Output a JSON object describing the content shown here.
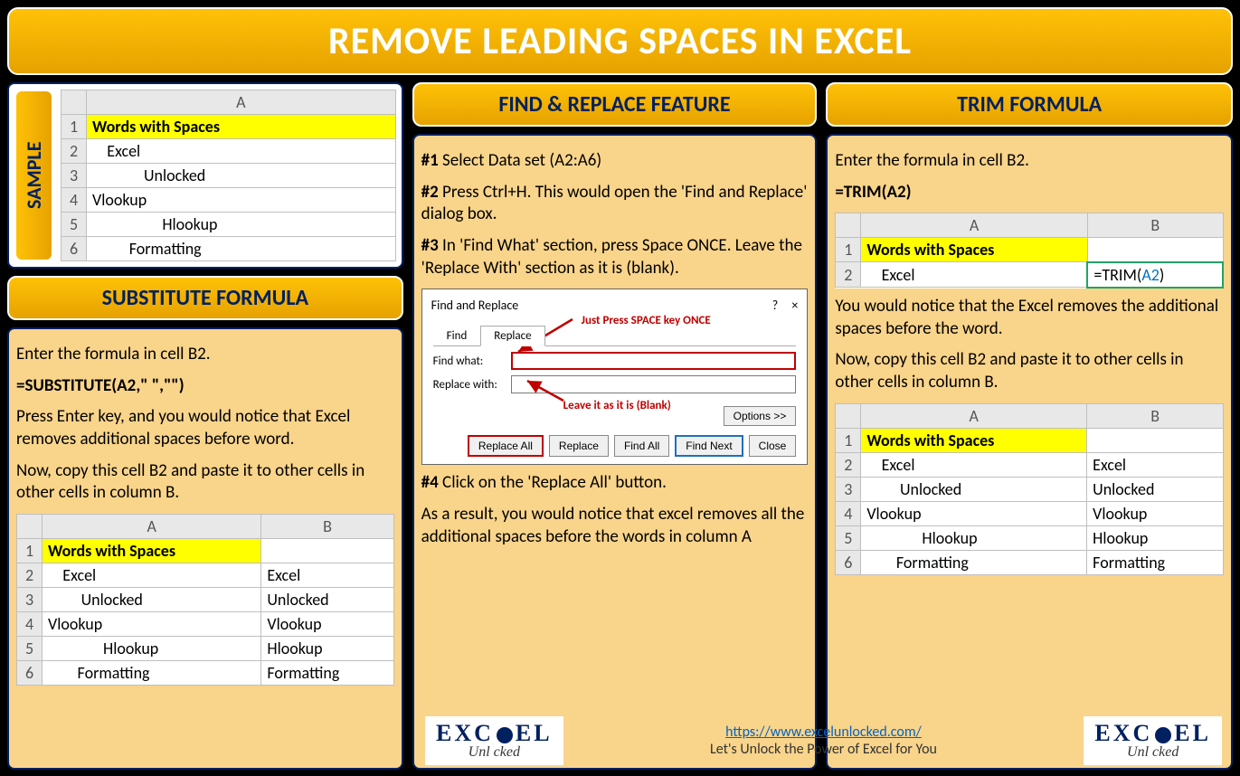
{
  "title": "REMOVE LEADING SPACES IN EXCEL",
  "sample": {
    "label": "SAMPLE",
    "col_header": "A",
    "header": "Words with Spaces",
    "rows": [
      "    Excel",
      "              Unlocked",
      "Vlookup",
      "                   Hlookup",
      "          Formatting"
    ]
  },
  "substitute": {
    "title": "SUBSTITUTE FORMULA",
    "intro": "Enter the formula in cell B2.",
    "formula": "=SUBSTITUTE(A2,\" \",\"\")",
    "p1": "Press Enter key, and you would notice that Excel removes additional spaces before word.",
    "p2": "Now, copy this cell B2 and paste it to other cells in other cells in column B.",
    "table": {
      "cols": [
        "A",
        "B"
      ],
      "header": "Words with Spaces",
      "rows": [
        {
          "a": "    Excel",
          "b": "Excel"
        },
        {
          "a": "         Unlocked",
          "b": "Unlocked"
        },
        {
          "a": "Vlookup",
          "b": "Vlookup"
        },
        {
          "a": "               Hlookup",
          "b": "Hlookup"
        },
        {
          "a": "        Formatting",
          "b": "Formatting"
        }
      ]
    }
  },
  "findreplace": {
    "title": "FIND & REPLACE FEATURE",
    "s1_prefix": "#1",
    "s1": " Select Data set (A2:A6)",
    "s2_prefix": "#2",
    "s2": " Press Ctrl+H. This would open the 'Find and Replace' dialog box.",
    "s3_prefix": "#3",
    "s3": " In 'Find What' section, press Space ONCE. Leave the 'Replace With' section as it is (blank).",
    "s4_prefix": "#4",
    "s4": " Click on the 'Replace All' button.",
    "result": "As a result, you would notice that excel removes all the additional spaces before the words in column A",
    "dialog": {
      "title": "Find and Replace",
      "help": "?",
      "close": "×",
      "tab_find": "Find",
      "tab_replace": "Replace",
      "find_label": "Find what:",
      "replace_label": "Replace with:",
      "note1": "Just Press SPACE key ONCE",
      "note2": "Leave it as it is (Blank)",
      "options": "Options >>",
      "btn_replace_all": "Replace All",
      "btn_replace": "Replace",
      "btn_find_all": "Find All",
      "btn_find_next": "Find Next",
      "btn_close": "Close"
    }
  },
  "trim": {
    "title": "TRIM FORMULA",
    "intro": "Enter the formula in cell B2.",
    "formula": "=TRIM(A2)",
    "mini": {
      "cols": [
        "A",
        "B"
      ],
      "header": "Words with Spaces",
      "row2a": "    Excel",
      "row2b_prefix": "=TRIM(",
      "row2b_ref": "A2",
      "row2b_suffix": ")"
    },
    "p1": "You would notice that the Excel removes the additional spaces before the word.",
    "p2": "Now, copy this cell B2 and paste it to other cells in other cells in column B.",
    "table": {
      "cols": [
        "A",
        "B"
      ],
      "header": "Words with Spaces",
      "rows": [
        {
          "a": "    Excel",
          "b": "Excel"
        },
        {
          "a": "         Unlocked",
          "b": "Unlocked"
        },
        {
          "a": "Vlookup",
          "b": "Vlookup"
        },
        {
          "a": "               Hlookup",
          "b": "Hlookup"
        },
        {
          "a": "        Formatting",
          "b": "Formatting"
        }
      ]
    }
  },
  "footer": {
    "url": "https://www.excelunlocked.com/",
    "tagline": "Let's Unlock the Power of Excel for You",
    "logo_top": "EXC  EL",
    "logo_bottom": "Unl   cked"
  }
}
